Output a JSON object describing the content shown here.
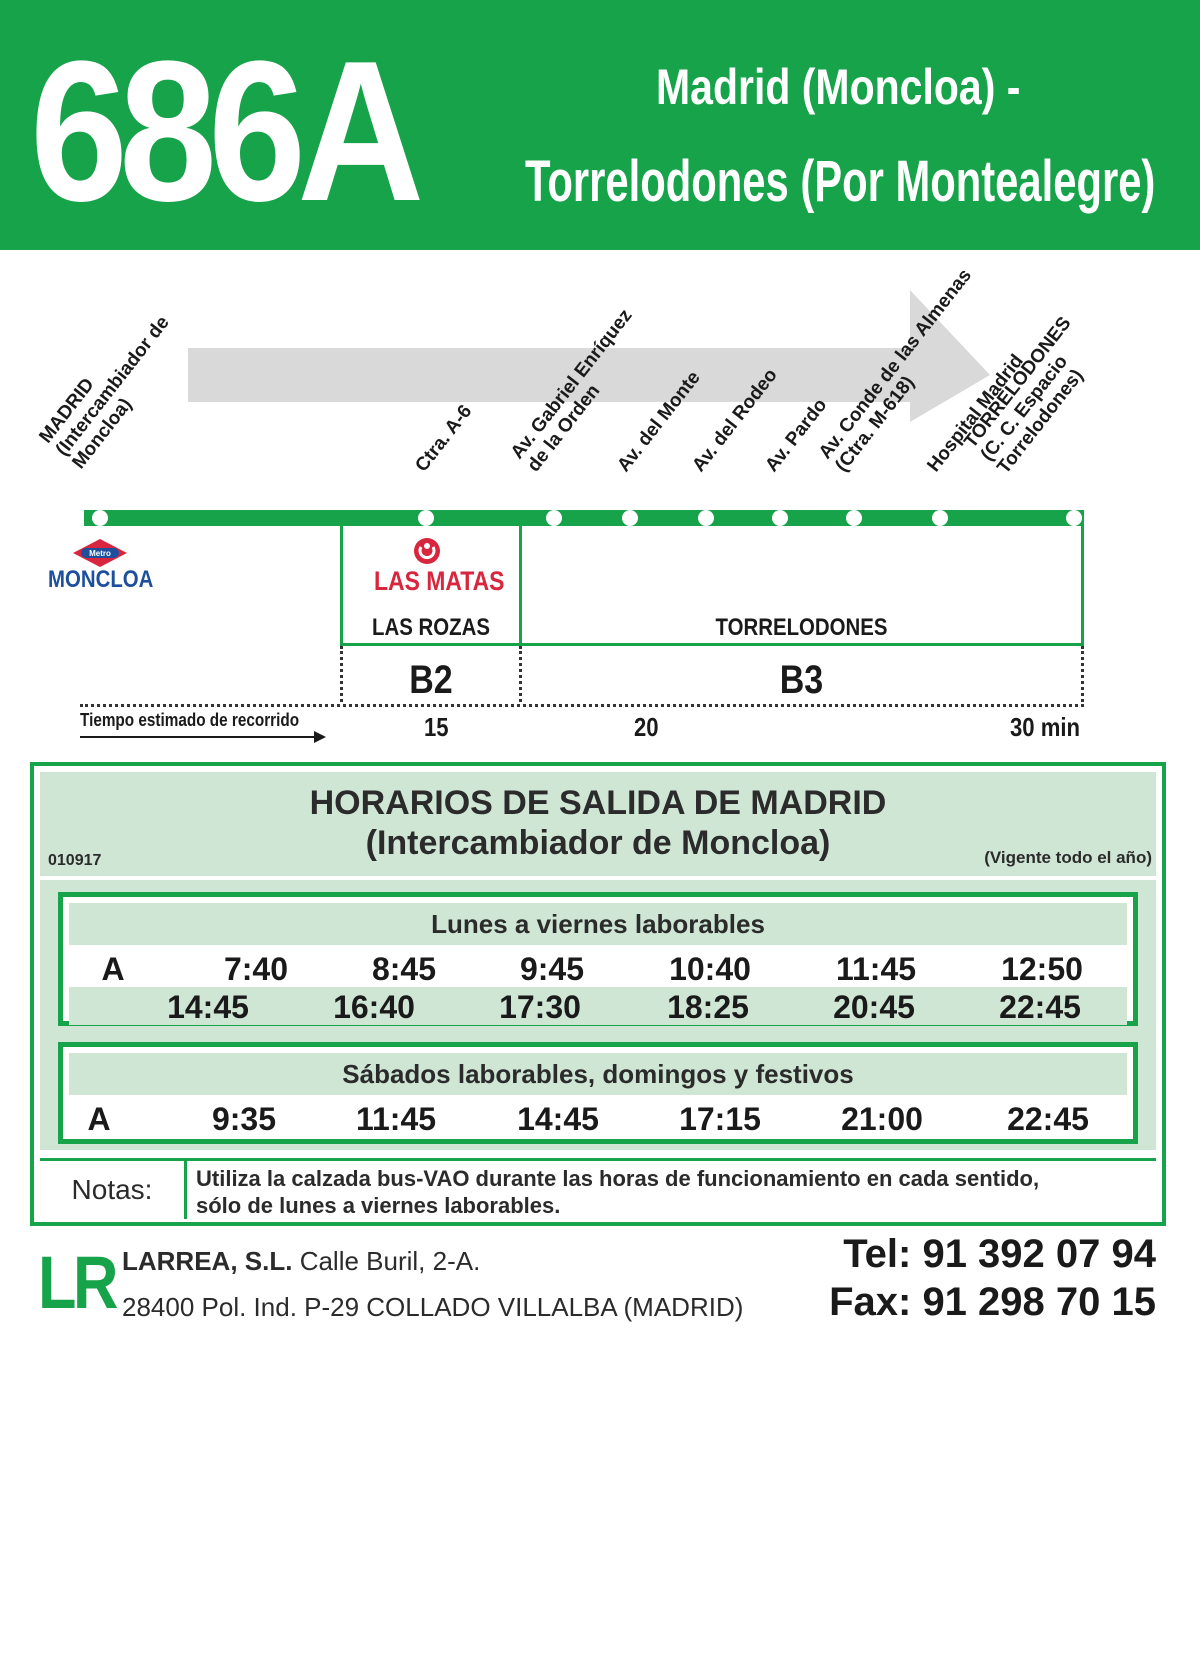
{
  "header": {
    "route_number": "686A",
    "route_line1": "Madrid (Moncloa) -",
    "route_line2": "Torrelodones (Por Montealegre)"
  },
  "stops": [
    {
      "label": "MADRID\n(Intercambiador de\nMoncloa)"
    },
    {
      "label": "Ctra. A-6"
    },
    {
      "label": "Av. Gabriel Enríquez\nde la Orden"
    },
    {
      "label": "Av. del Monte"
    },
    {
      "label": "Av. del Rodeo"
    },
    {
      "label": "Av. Pardo"
    },
    {
      "label": "Av. Conde de las Almenas\n(Ctra. M-618)"
    },
    {
      "label": "Hospital Madrid"
    },
    {
      "label": "TORRELODONES\n(C. C. Espacio\nTorrelodones)"
    }
  ],
  "connections": {
    "metro_badge": "Metro",
    "metro_station": "MONCLOA",
    "cercanias_station": "LAS MATAS"
  },
  "zones": {
    "zone1_name": "LAS ROZAS",
    "zone2_name": "TORRELODONES",
    "fare1": "B2",
    "fare2": "B3"
  },
  "travel_time": {
    "caption": "Tiempo estimado de recorrido",
    "t1": "15",
    "t2": "20",
    "t3": "30 min"
  },
  "timetable": {
    "title_line1": "HORARIOS DE SALIDA DE MADRID",
    "title_line2": "(Intercambiador de Moncloa)",
    "code": "010917",
    "validity": "(Vigente todo el año)",
    "weekday": {
      "heading": "Lunes a viernes laborables",
      "row1": [
        "A",
        "7:40",
        "8:45",
        "9:45",
        "10:40",
        "11:45",
        "12:50"
      ],
      "row2": [
        "14:45",
        "16:40",
        "17:30",
        "18:25",
        "20:45",
        "22:45"
      ]
    },
    "weekend": {
      "heading": "Sábados laborables, domingos y festivos",
      "row1": [
        "A",
        "9:35",
        "11:45",
        "14:45",
        "17:15",
        "21:00",
        "22:45"
      ]
    },
    "notes_label": "Notas:",
    "notes_line1": "Utiliza la calzada bus-VAO durante las horas de funcionamiento en cada sentido,",
    "notes_line2": "sólo de lunes a viernes laborables."
  },
  "footer": {
    "logo": "LR",
    "company_name": "LARREA, S.L.",
    "company_street": "Calle Buril, 2-A.",
    "company_address": "28400 Pol. Ind. P-29 COLLADO VILLALBA (MADRID)",
    "tel": "Tel: 91 392 07 94",
    "fax": "Fax: 91 298 70 15"
  },
  "colors": {
    "brand_green": "#17a34a",
    "light_green": "#cfe6d5",
    "metro_blue": "#1d4f9c",
    "renfe_red": "#d7263d"
  }
}
